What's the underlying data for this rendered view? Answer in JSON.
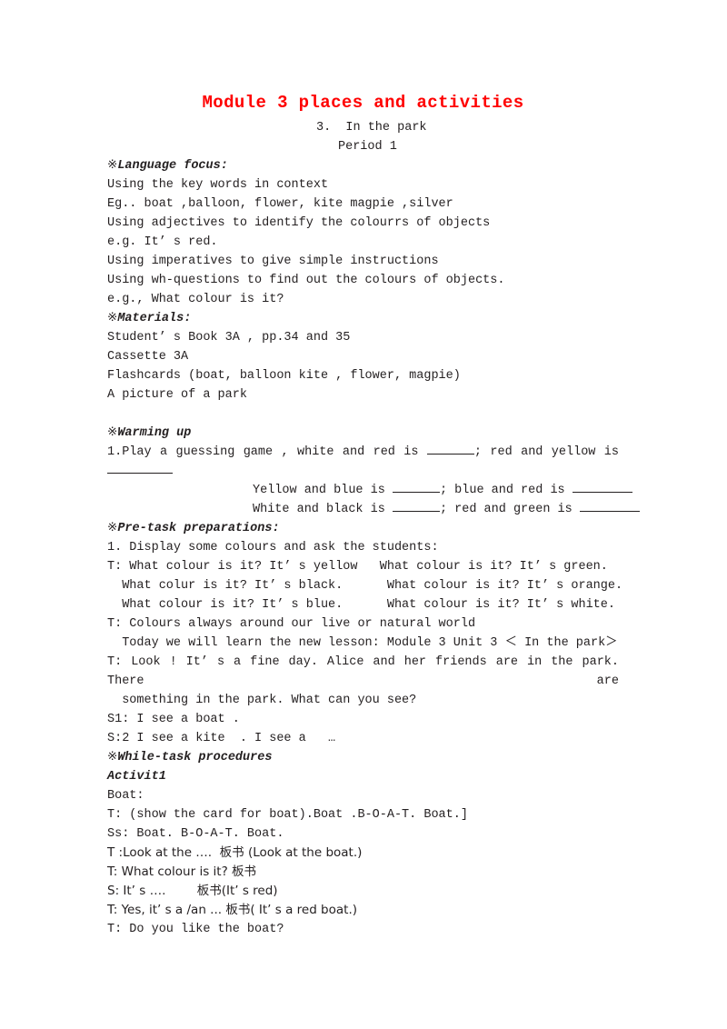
{
  "document": {
    "title": "Module 3 places and activities",
    "title_color": "#ff0000",
    "subtitle_1": "3.  In the park",
    "subtitle_2": "Period 1"
  },
  "sections": {
    "language_focus": {
      "mark": "※",
      "heading": "Language focus:",
      "lines": [
        "Using the key words in context",
        "Eg.. boat ,balloon, flower, kite magpie ,silver",
        "Using adjectives to identify the colourrs of objects",
        "e.g. It’ s red.",
        "Using imperatives to give simple instructions",
        "Using wh-questions to find out the colours of objects.",
        "e.g., What colour is it?"
      ]
    },
    "materials": {
      "mark": "※",
      "heading": "Materials:",
      "lines": [
        "Student’ s Book 3A , pp.34 and 35",
        "Cassette 3A",
        "Flashcards (boat, balloon kite , flower, magpie)",
        "A picture of a park"
      ]
    },
    "warming_up": {
      "mark": "※",
      "heading": "Warming up",
      "item1_text": "1.Play a guessing  game  , white and red is ______; red and yellow is",
      "item1_part_a": "1.Play a guessing  game  , white and red is",
      "item1_part_b": "; red and yellow is",
      "item1_wrap": "__________",
      "row_yellow_a": "Yellow and blue is",
      "row_yellow_b": "; blue and red is",
      "row_white_a": "White and black is",
      "row_white_b": "; red and green is"
    },
    "pre_task": {
      "mark": "※",
      "heading": "Pre-task preparations:",
      "lines": [
        "1. Display some colours and ask the students:",
        "T: What colour is it? It’ s yellow   What colour is it? It’ s green.",
        "  What colur is it? It’ s black.      What colour is it? It’ s orange.",
        "  What colour is it? It’ s blue.      What colour is it? It’ s white.",
        "T: Colours always around our live or natural world",
        "  Today we will learn the new lesson: Module 3 Unit 3 ＜ In the park＞"
      ],
      "justified_line": "T: Look ! It’ s a fine day. Alice and her friends are in the park. There are",
      "justified_cont": "  something in the park. What can you see?",
      "student_lines": [
        "S1: I see a boat .",
        "S:2 I see a kite  . I see a   …"
      ]
    },
    "while_task": {
      "mark": "※",
      "heading": "While-task procedures",
      "activity": "Activit1",
      "lines": [
        "Boat:",
        "T: (show the card for boat).Boat .B-O-A-T. Boat.]",
        "Ss: Boat. B-O-A-T. Boat.",
        "T :Look at the ….  板书 (Look at the boat.)",
        "T: What colour is it? 板书",
        "S: It’ s ….        板书(It’ s red)",
        "T: Yes, it’ s a /an ... 板书( It’ s a red boat.)",
        "T: Do you like the boat?"
      ]
    }
  }
}
